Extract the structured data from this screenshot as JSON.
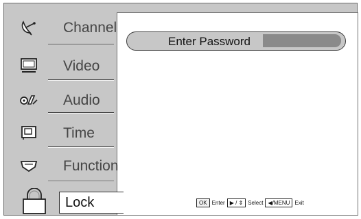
{
  "menu": {
    "items": [
      {
        "label": "Channel",
        "icon": "satellite-dish-icon"
      },
      {
        "label": "Video",
        "icon": "monitor-icon"
      },
      {
        "label": "Audio",
        "icon": "audio-icon"
      },
      {
        "label": "Time",
        "icon": "clock-screen-icon"
      },
      {
        "label": "Function",
        "icon": "function-tray-icon"
      },
      {
        "label": "Lock",
        "icon": "padlock-icon",
        "selected": true
      }
    ]
  },
  "password": {
    "label": "Enter Password",
    "value": ""
  },
  "hint": {
    "ok_key": "OK",
    "ok_action": "Enter",
    "select_key": "▶ / ⇕",
    "select_action": "Select",
    "exit_key": "◀/MENU",
    "exit_action": "Exit"
  },
  "colors": {
    "panel": "#c7c7c7",
    "content": "#ffffff",
    "field": "#8a8a8a"
  }
}
